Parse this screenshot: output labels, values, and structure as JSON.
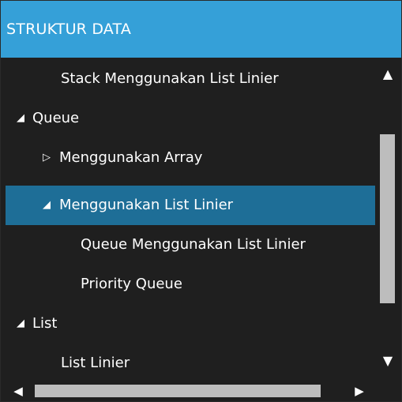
{
  "header": {
    "title": "STRUKTUR DATA"
  },
  "tree": {
    "rows": [
      {
        "label": "Stack Menggunakan List Linier",
        "arrow": ""
      },
      {
        "label": "Queue",
        "arrow": "◢"
      },
      {
        "label": "Menggunakan Array",
        "arrow": "▷"
      },
      {
        "label": "Menggunakan List Linier",
        "arrow": "◢",
        "selected": true
      },
      {
        "label": "Queue Menggunakan List Linier",
        "arrow": ""
      },
      {
        "label": "Priority Queue",
        "arrow": ""
      },
      {
        "label": "List",
        "arrow": "◢"
      },
      {
        "label": "List Linier",
        "arrow": ""
      }
    ]
  },
  "scrollbars": {
    "up": "▲",
    "down": "▼",
    "left": "◀",
    "right": "▶"
  },
  "colors": {
    "header": "#35a0d8",
    "background": "#1f1f1f",
    "selection": "#1e6e97",
    "scroll_thumb": "#bdbdbd"
  }
}
